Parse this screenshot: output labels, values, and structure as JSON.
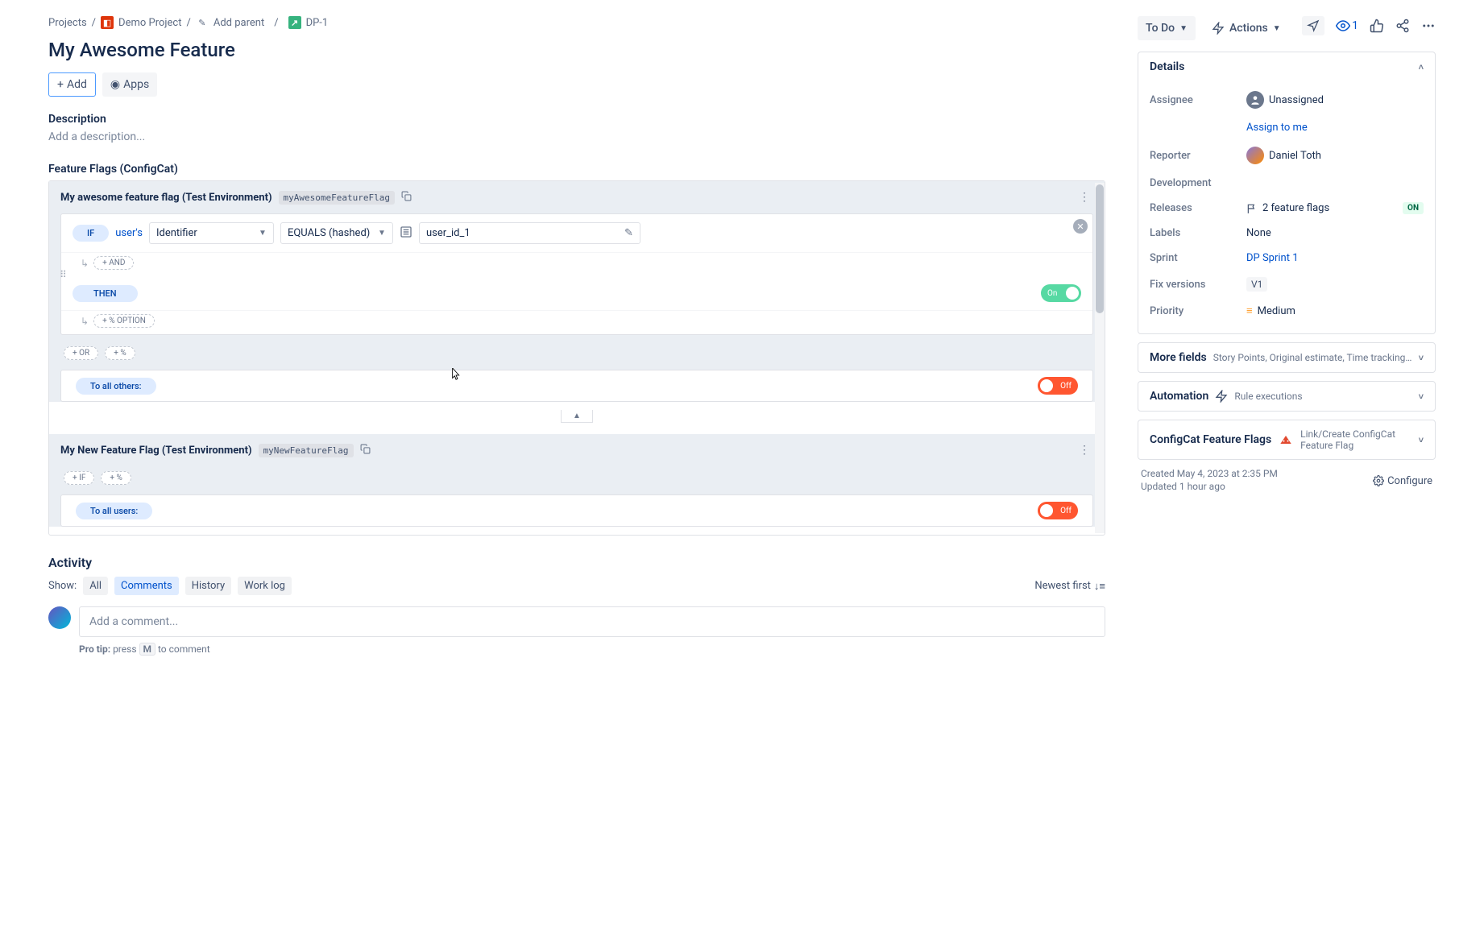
{
  "breadcrumb": {
    "projects": "Projects",
    "demo": "Demo Project",
    "add_parent": "Add parent",
    "issue_key": "DP-1"
  },
  "title": "My Awesome Feature",
  "toolbar": {
    "add": "Add",
    "apps": "Apps"
  },
  "description": {
    "label": "Description",
    "placeholder": "Add a description..."
  },
  "ff_section": "Feature Flags (ConfigCat)",
  "flag1": {
    "title": "My awesome feature flag (Test Environment)",
    "key": "myAwesomeFeatureFlag",
    "if": "IF",
    "users": "user's",
    "identifier": "Identifier",
    "equals": "EQUALS (hashed)",
    "user_id": "user_id_1",
    "and": "+ AND",
    "then": "THEN",
    "on": "On",
    "option": "+ % OPTION",
    "or": "+ OR",
    "pct": "+ %",
    "to_others": "To all others:",
    "off": "Off"
  },
  "flag2": {
    "title": "My New Feature Flag (Test Environment)",
    "key": "myNewFeatureFlag",
    "if": "+ IF",
    "pct": "+ %",
    "to_users": "To all users:",
    "off": "Off"
  },
  "activity": {
    "title": "Activity",
    "show": "Show:",
    "tabs": {
      "all": "All",
      "comments": "Comments",
      "history": "History",
      "worklog": "Work log"
    },
    "newest": "Newest first",
    "comment_placeholder": "Add a comment...",
    "protip_label": "Pro tip:",
    "protip_press": "press",
    "protip_key": "M",
    "protip_rest": "to comment"
  },
  "top_icons": {
    "watchers": "1"
  },
  "status": {
    "todo": "To Do",
    "actions": "Actions"
  },
  "details": {
    "title": "Details",
    "assignee_label": "Assignee",
    "assignee_value": "Unassigned",
    "assign_to_me": "Assign to me",
    "reporter_label": "Reporter",
    "reporter_value": "Daniel Toth",
    "development_label": "Development",
    "releases_label": "Releases",
    "releases_value": "2 feature flags",
    "releases_badge": "ON",
    "labels_label": "Labels",
    "labels_value": "None",
    "sprint_label": "Sprint",
    "sprint_value": "DP Sprint 1",
    "fix_label": "Fix versions",
    "fix_value": "V1",
    "priority_label": "Priority",
    "priority_value": "Medium"
  },
  "more_fields": {
    "title": "More fields",
    "text": "Story Points, Original estimate, Time tracking, Epic Link, Compone..."
  },
  "automation": {
    "title": "Automation",
    "text": "Rule executions"
  },
  "configcat": {
    "title": "ConfigCat Feature Flags",
    "text": "Link/Create ConfigCat Feature Flag"
  },
  "meta": {
    "created": "Created May 4, 2023 at 2:35 PM",
    "updated": "Updated 1 hour ago",
    "configure": "Configure"
  }
}
